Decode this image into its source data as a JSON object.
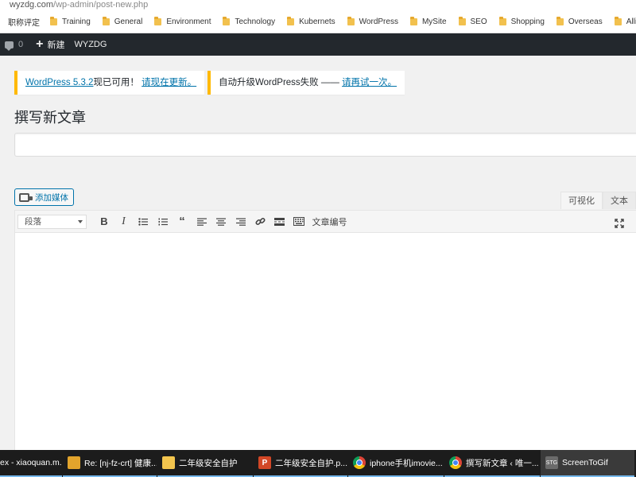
{
  "browser": {
    "url_host": "wyzdg.com",
    "url_path": "/wp-admin/post-new.php"
  },
  "bookmarks": [
    {
      "label": "职称评定",
      "folder": false
    },
    {
      "label": "Training",
      "folder": true
    },
    {
      "label": "General",
      "folder": true
    },
    {
      "label": "Environment",
      "folder": true
    },
    {
      "label": "Technology",
      "folder": true
    },
    {
      "label": "Kubernets",
      "folder": true
    },
    {
      "label": "WordPress",
      "folder": true
    },
    {
      "label": "MySite",
      "folder": true
    },
    {
      "label": "SEO",
      "folder": true
    },
    {
      "label": "Shopping",
      "folder": true
    },
    {
      "label": "Overseas",
      "folder": true
    },
    {
      "label": "Alliance",
      "folder": true
    }
  ],
  "adminbar": {
    "comments_count": "0",
    "new_label": "新建",
    "site_label": "WYZDG"
  },
  "notices": {
    "update_link": "WordPress 5.3.2",
    "update_text": "现已可用！",
    "update_action": "请现在更新。",
    "autoupdate_text": "自动升级WordPress失败 —— ",
    "autoupdate_action": "请再试一次。"
  },
  "page": {
    "title": "撰写新文章",
    "title_input_value": ""
  },
  "editor": {
    "add_media_label": "添加媒体",
    "tab_visual": "可视化",
    "tab_text": "文本",
    "format_select": "段落",
    "more_text": "文章编号"
  },
  "taskbar": [
    {
      "label": "ex - xiaoquan.m...",
      "icon": "none"
    },
    {
      "label": "Re: [nj-fz-crt] 健康...",
      "icon": "mail"
    },
    {
      "label": "二年级安全自护",
      "icon": "folder"
    },
    {
      "label": "二年级安全自护.p...",
      "icon": "ppt"
    },
    {
      "label": "iphone手机imovie...",
      "icon": "chrome"
    },
    {
      "label": "撰写新文章 ‹ 唯一...",
      "icon": "chrome"
    },
    {
      "label": "ScreenToGif",
      "icon": "stg"
    }
  ],
  "colors": {
    "adminbar_bg": "#23282d",
    "notice_border": "#ffb900",
    "link": "#0073aa",
    "taskbar_bg": "#1c1c1c"
  }
}
